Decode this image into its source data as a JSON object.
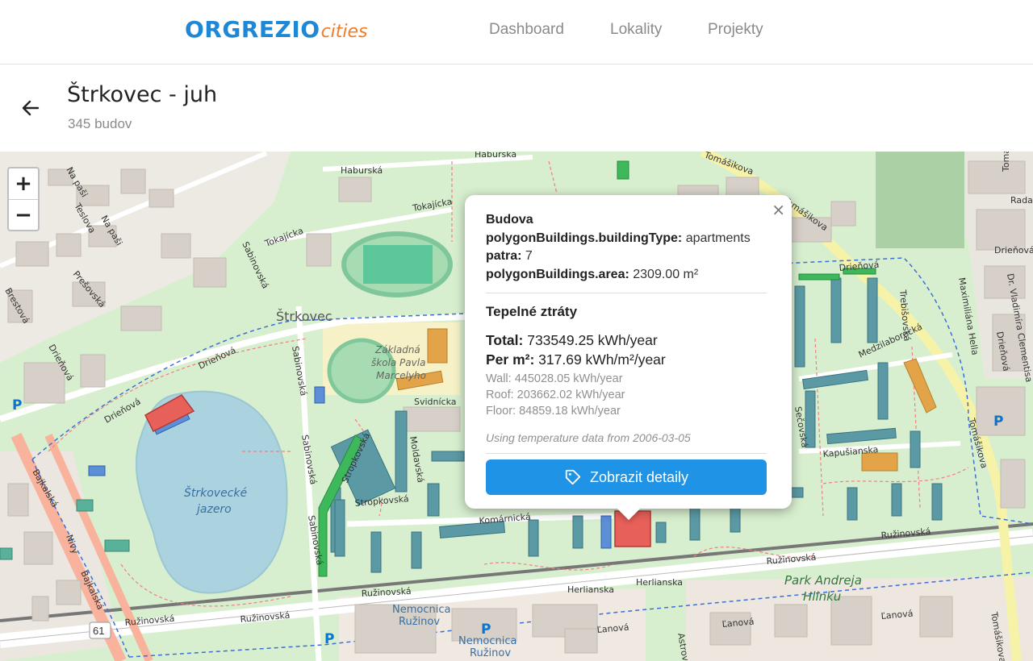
{
  "brand": {
    "name_main": "ORGREZIO",
    "name_sub": "cities"
  },
  "nav": {
    "items": [
      "Dashboard",
      "Lokality",
      "Projekty"
    ]
  },
  "header": {
    "title": "Štrkovec - juh",
    "subtitle": "345 budov"
  },
  "map": {
    "zoom_in": "+",
    "zoom_out": "−",
    "labels": {
      "lake": [
        "Štrkovecké",
        "jazero"
      ],
      "area": "Štrkovec",
      "school": [
        "Základná",
        "škola Pavla",
        "Marcelyho"
      ],
      "park": [
        "Park Andreja",
        "Hlinku"
      ],
      "hospital": [
        "Nemocnica",
        "Ružinov"
      ],
      "hospital2": [
        "Nemocnica",
        "Ružinov"
      ],
      "streets": [
        "Haburská",
        "Haburská",
        "Tokajícka",
        "Tokajícka",
        "Tomášikova",
        "Tomášikova",
        "Tomášikova",
        "Tomášikova",
        "Tomášikova",
        "Ružinovská",
        "Ružinovská",
        "Ružinovská",
        "Ružinovská",
        "Ružinovská",
        "Drieňová",
        "Drieňová",
        "Drieňová",
        "Drieňová",
        "Drieňová",
        "Sabinovská",
        "Sabinovská",
        "Sabinovská",
        "Sabinovská",
        "Svidnícka",
        "Stropkovská",
        "Stropkovská",
        "Komárnická",
        "Herlianska",
        "Herlianska",
        "Medzilaborecká",
        "Kapušianska",
        "Trebišovská",
        "Sečovská",
        "Moldavská",
        "Maximiliána Hella",
        "Dr. Vladimíra Clementisa",
        "Bajkalská",
        "Bajkalská",
        "Prešovská",
        "Brestová",
        "Teslova",
        "Na paši",
        "Na paši",
        "Radarová",
        "Ľanová",
        "Ľanová",
        "Ľanová",
        "Astrová",
        "Nivy",
        "Drieňová"
      ],
      "road_number": "61",
      "parking": "P"
    }
  },
  "popup": {
    "close": "×",
    "heading": "Budova",
    "building_type_label": "polygonBuildings.buildingType:",
    "building_type_value": "apartments",
    "floors_label": "patra:",
    "floors_value": "7",
    "area_label": "polygonBuildings.area:",
    "area_value": "2309.00 m²",
    "heat_title": "Tepelné ztráty",
    "total_label": "Total:",
    "total_value": "733549.25 kWh/year",
    "per_m2_label": "Per m²:",
    "per_m2_value": "317.69 kWh/m²/year",
    "wall": "Wall: 445028.05 kWh/year",
    "roof": "Roof: 203662.02 kWh/year",
    "floor": "Floor: 84859.18 kWh/year",
    "note": "Using temperature data from 2006-03-05",
    "button_label": "Zobrazit detaily"
  },
  "colors": {
    "accent": "#1f93e5",
    "brand_blue": "#1f88d6",
    "brand_orange": "#f07d2b",
    "selected_building": "#e8605a",
    "building_teal": "#5b9aa5",
    "building_orange": "#e3a449",
    "building_green": "#3db85a"
  }
}
